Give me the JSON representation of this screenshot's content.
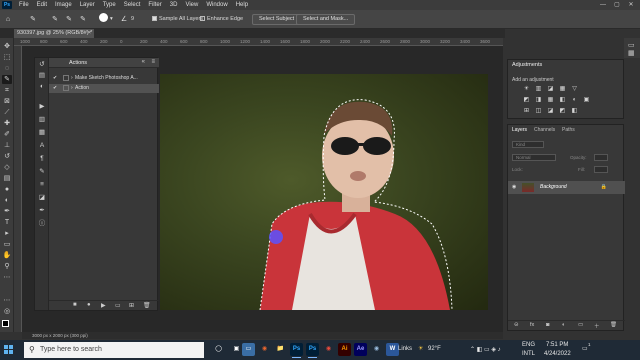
{
  "app": {
    "logo": "Ps",
    "menus": [
      "File",
      "Edit",
      "Image",
      "Layer",
      "Type",
      "Select",
      "Filter",
      "3D",
      "View",
      "Window",
      "Help"
    ],
    "window_controls": [
      "—",
      "▢",
      "✕"
    ]
  },
  "options": {
    "brush_size": "9",
    "sample_all_layers": "Sample All Layers",
    "enhance_edge": "Enhance Edge",
    "select_subject": "Select Subject",
    "select_and_mask": "Select and Mask..."
  },
  "document": {
    "tab_title": "930397.jpg @ 25% (RGB/8#) *",
    "status": "3000 px x 2000 px (300 ppi)",
    "ruler_ticks": [
      "1000",
      "800",
      "600",
      "400",
      "200",
      "0",
      "200",
      "400",
      "600",
      "800",
      "1000",
      "1200",
      "1400",
      "1600",
      "1800",
      "2000",
      "2200",
      "2400",
      "2600",
      "2800",
      "3000",
      "3200",
      "3400",
      "3600",
      "3800"
    ]
  },
  "actions_panel": {
    "title": "Actions",
    "menu_icon": "≡",
    "collapse": "«",
    "rows": [
      {
        "check": "✔",
        "toggle": "›",
        "label": "Make Sketch Photoshop A..."
      },
      {
        "check": "✔",
        "toggle": "›",
        "label": "Action"
      }
    ]
  },
  "adjustments_panel": {
    "title": "Adjustments",
    "add_label": "Add an adjustment",
    "icons": [
      "☀",
      "▥",
      "◪",
      "▦",
      "▽",
      "◩",
      "◨",
      "▦",
      "◧",
      "◐",
      "▣",
      "⊞",
      "◫",
      "◪",
      "◩",
      "◧"
    ]
  },
  "layers_panel": {
    "tabs": [
      "Layers",
      "Channels",
      "Paths"
    ],
    "kind_placeholder": "Kind",
    "blend_mode": "Normal",
    "opacity_label": "Opacity:",
    "lock_label": "Lock:",
    "fill_label": "Fill:",
    "background_layer": "Background",
    "footer_icons": [
      "⊝",
      "fx",
      "◙",
      "◐",
      "▭",
      "＋",
      "🗑"
    ]
  },
  "taskbar": {
    "search_placeholder": "Type here to search",
    "apps": [
      "◯",
      "▣",
      "▭",
      "◉",
      "📁",
      "Ps",
      "Ps",
      "◉",
      "Ai",
      "Ae",
      "◉",
      "W"
    ],
    "links_label": "Links",
    "weather": "92°F",
    "language_1": "ENG",
    "language_2": "INTL",
    "time": "7:51 PM",
    "date": "4/24/2022",
    "notification_count": "1"
  },
  "colors": {
    "accent": "#31a8ff",
    "panel_bg": "#383838",
    "taskbar_bg": "#1f2a36"
  }
}
